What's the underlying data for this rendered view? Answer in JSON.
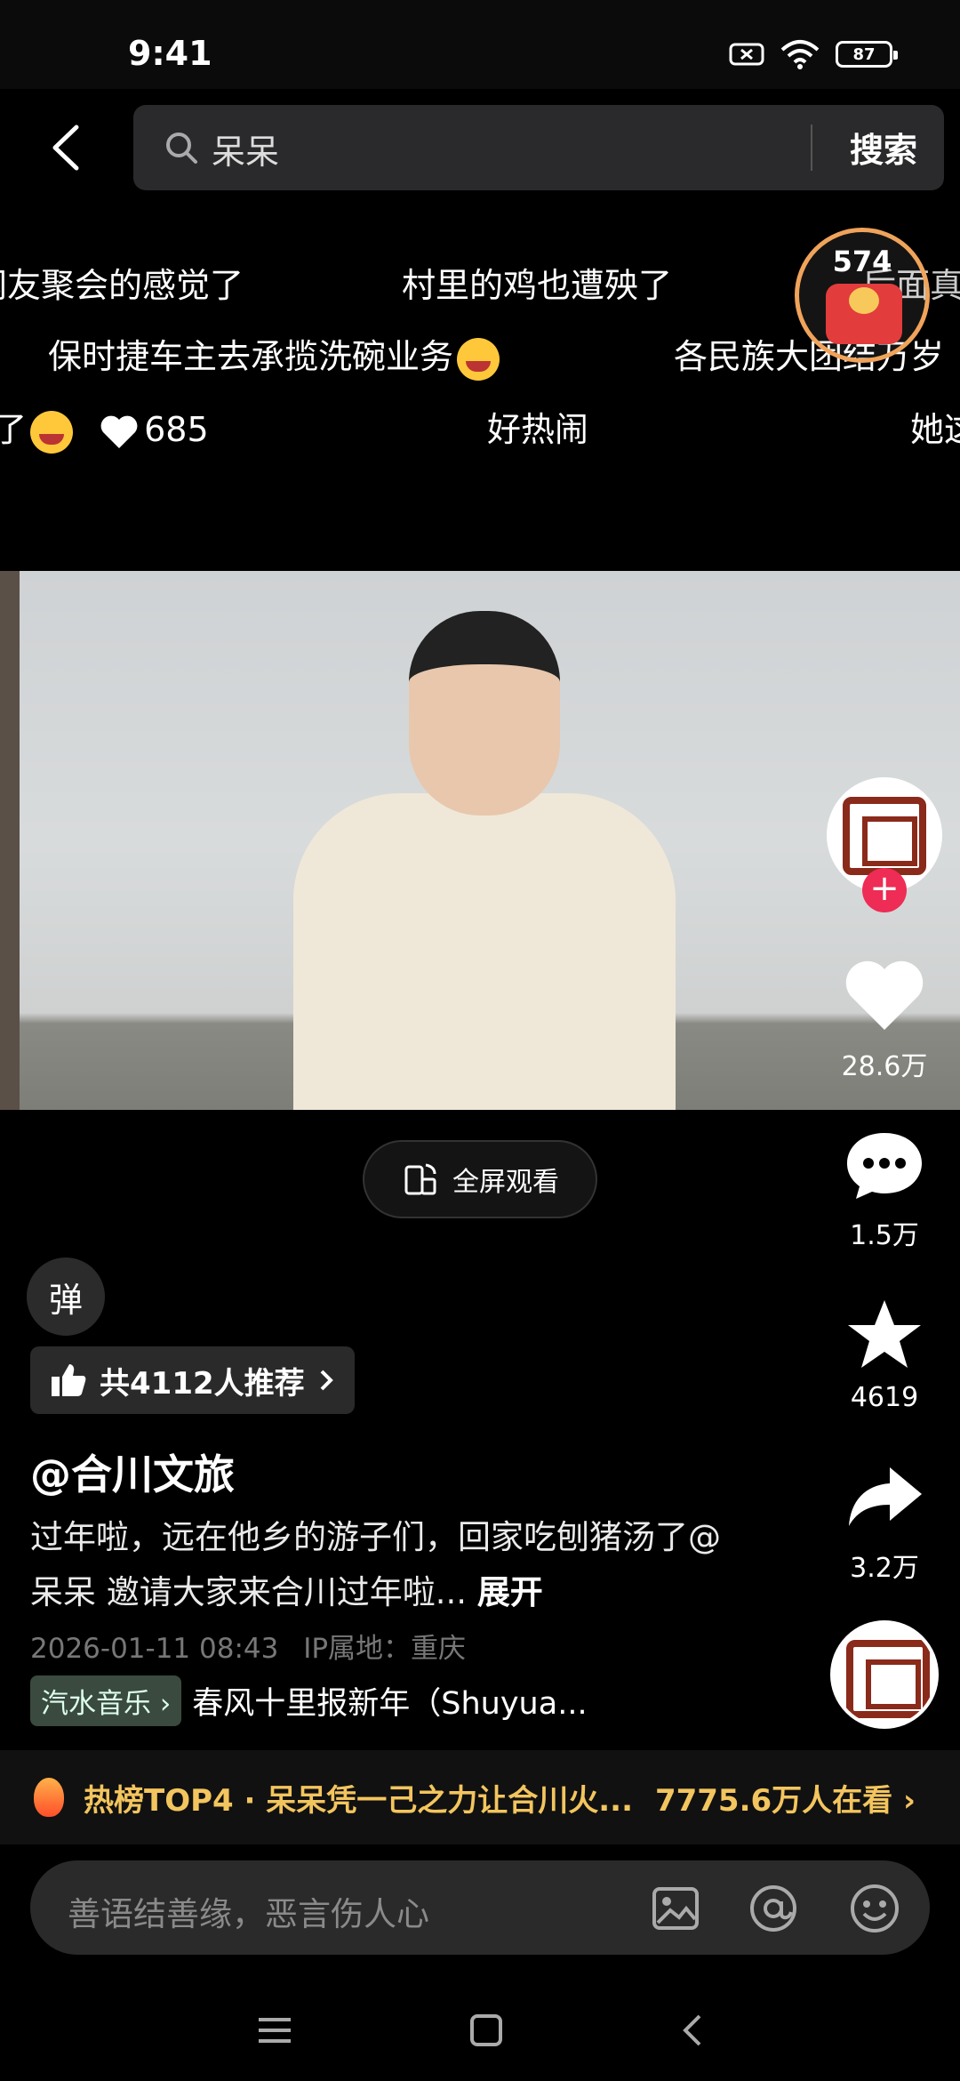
{
  "status": {
    "time": "9:41",
    "battery": "87"
  },
  "search": {
    "query": "呆呆",
    "button": "搜索"
  },
  "danmaku": {
    "row1": [
      "网友聚会的感觉了",
      "村里的鸡也遭殃了",
      "后面真"
    ],
    "row2": [
      "保时捷车主去承揽洗碗业务",
      "各民族大团结万岁"
    ],
    "row3": [
      "了",
      "685",
      "好热闹",
      "她这"
    ]
  },
  "redpacket": {
    "count": "574"
  },
  "video": {
    "fullscreen_label": "全屏观看"
  },
  "rail": {
    "likes": "28.6万",
    "comments": "1.5万",
    "favorites": "4619",
    "shares": "3.2万"
  },
  "post": {
    "danmu_toggle": "弹",
    "recommend": "共4112人推荐",
    "author": "@合川文旅",
    "caption": "过年啦，远在他乡的游子们，回家吃刨猪汤了@呆呆 邀请大家来合川过年啦...",
    "expand": "展开",
    "date": "2026-01-11 08:43",
    "ip": "IP属地：重庆",
    "music_tag": "汽水音乐",
    "music_title": "春风十里报新年（Shuyua..."
  },
  "hot": {
    "text": "热榜TOP4 · 呆呆凭一己之力让合川火...",
    "watching": "7775.6万人在看"
  },
  "comment": {
    "placeholder": "善语结善缘，恶言伤人心"
  }
}
